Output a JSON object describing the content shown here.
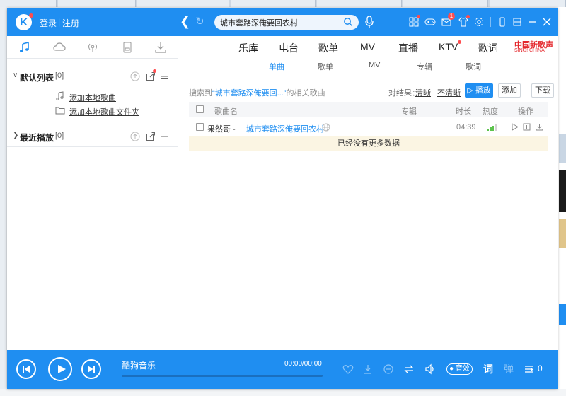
{
  "app": {
    "login": "登录",
    "separator": "|",
    "register": "注册",
    "search_query": "城市套路深俺要回农村",
    "notification_count": "1"
  },
  "top_nav": [
    "乐库",
    "电台",
    "歌单",
    "MV",
    "直播",
    "KTV",
    "歌词"
  ],
  "promo": {
    "line1": "中国新歌声",
    "line2": "SING! CHINA"
  },
  "sub_tabs": [
    "单曲",
    "歌单",
    "MV",
    "专辑",
    "歌词"
  ],
  "active_sub_tab": "单曲",
  "playlists": [
    {
      "name": "默认列表",
      "count": "[0]"
    },
    {
      "name": "最近播放",
      "count": "[0]"
    }
  ],
  "add_actions": [
    "添加本地歌曲",
    "添加本地歌曲文件夹"
  ],
  "results": {
    "prefix": "搜索到",
    "keyword": "“城市套路深俺要回...”",
    "suffix": "的相关歌曲",
    "label": "对结果：",
    "clear": "清晰",
    "standard": "不清晰",
    "play": "▷ 播放",
    "add": "添加",
    "download": "下载"
  },
  "table": {
    "headers": {
      "song": "歌曲名",
      "album": "专辑",
      "duration": "时长",
      "heat": "热度",
      "actions": "操作"
    },
    "rows": [
      {
        "artist": "果然哥 - ",
        "song": "城市套路深俺要回农村",
        "duration": "04:39",
        "heat": 0.75
      }
    ],
    "no_more": "已经没有更多数据"
  },
  "player": {
    "title": "酷狗音乐",
    "time": "00:00/00:00",
    "progress": 0,
    "sound_effect": "音效",
    "lyrics": "词",
    "danmu": "弹",
    "queue_count": "0"
  },
  "colors": {
    "accent": "#1f8ef1",
    "badge": "#ff4d4f",
    "heat": "#5dc34e",
    "notice_bg": "#fbf5e3"
  }
}
